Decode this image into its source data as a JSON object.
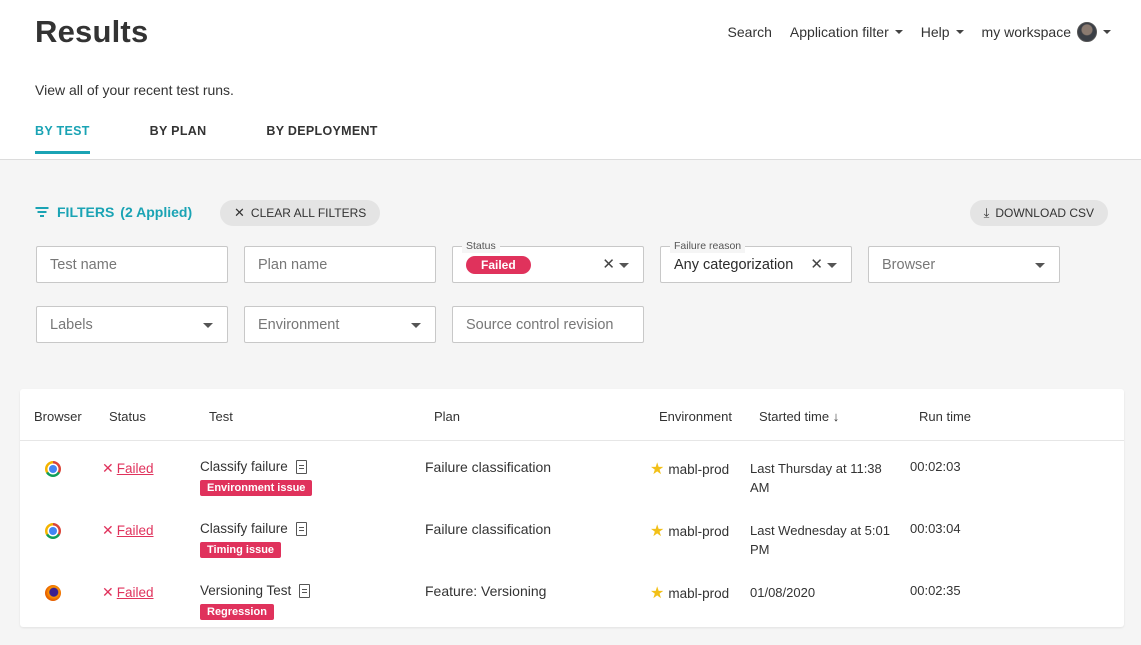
{
  "page": {
    "title": "Results",
    "subtitle": "View all of your recent test runs."
  },
  "topnav": {
    "search": "Search",
    "app_filter": "Application filter",
    "help": "Help",
    "workspace": "my workspace"
  },
  "tabs": [
    {
      "label": "BY TEST",
      "active": true
    },
    {
      "label": "BY PLAN",
      "active": false
    },
    {
      "label": "BY DEPLOYMENT",
      "active": false
    }
  ],
  "filters": {
    "toggle_label": "FILTERS",
    "applied_count": "(2 Applied)",
    "clear_all": "CLEAR ALL FILTERS",
    "download_csv": "DOWNLOAD CSV",
    "test_name_placeholder": "Test name",
    "plan_name_placeholder": "Plan name",
    "status_legend": "Status",
    "status_value": "Failed",
    "failure_reason_legend": "Failure reason",
    "failure_reason_value": "Any categorization",
    "browser_placeholder": "Browser",
    "labels_placeholder": "Labels",
    "environment_placeholder": "Environment",
    "source_control_placeholder": "Source control revision"
  },
  "table": {
    "columns": [
      "Browser",
      "Status",
      "Test",
      "Plan",
      "Environment",
      "Started time ↓",
      "Run time"
    ],
    "rows": [
      {
        "browser": "chrome-icon",
        "status": "Failed",
        "test": "Classify failure",
        "tag": "Environment issue",
        "plan": "Failure classification",
        "environment": "mabl-prod",
        "started": "Last Thursday at 11:38 AM",
        "run_time": "00:02:03"
      },
      {
        "browser": "chrome-icon",
        "status": "Failed",
        "test": "Classify failure",
        "tag": "Timing issue",
        "plan": "Failure classification",
        "environment": "mabl-prod",
        "started": "Last Wednesday at 5:01 PM",
        "run_time": "00:03:04"
      },
      {
        "browser": "firefox-icon",
        "status": "Failed",
        "test": "Versioning Test",
        "tag": "Regression",
        "plan": "Feature: Versioning",
        "environment": "mabl-prod",
        "started": "01/08/2020",
        "run_time": "00:02:35"
      }
    ]
  },
  "colors": {
    "accent": "#1aa3b4",
    "failed": "#e0325c"
  }
}
